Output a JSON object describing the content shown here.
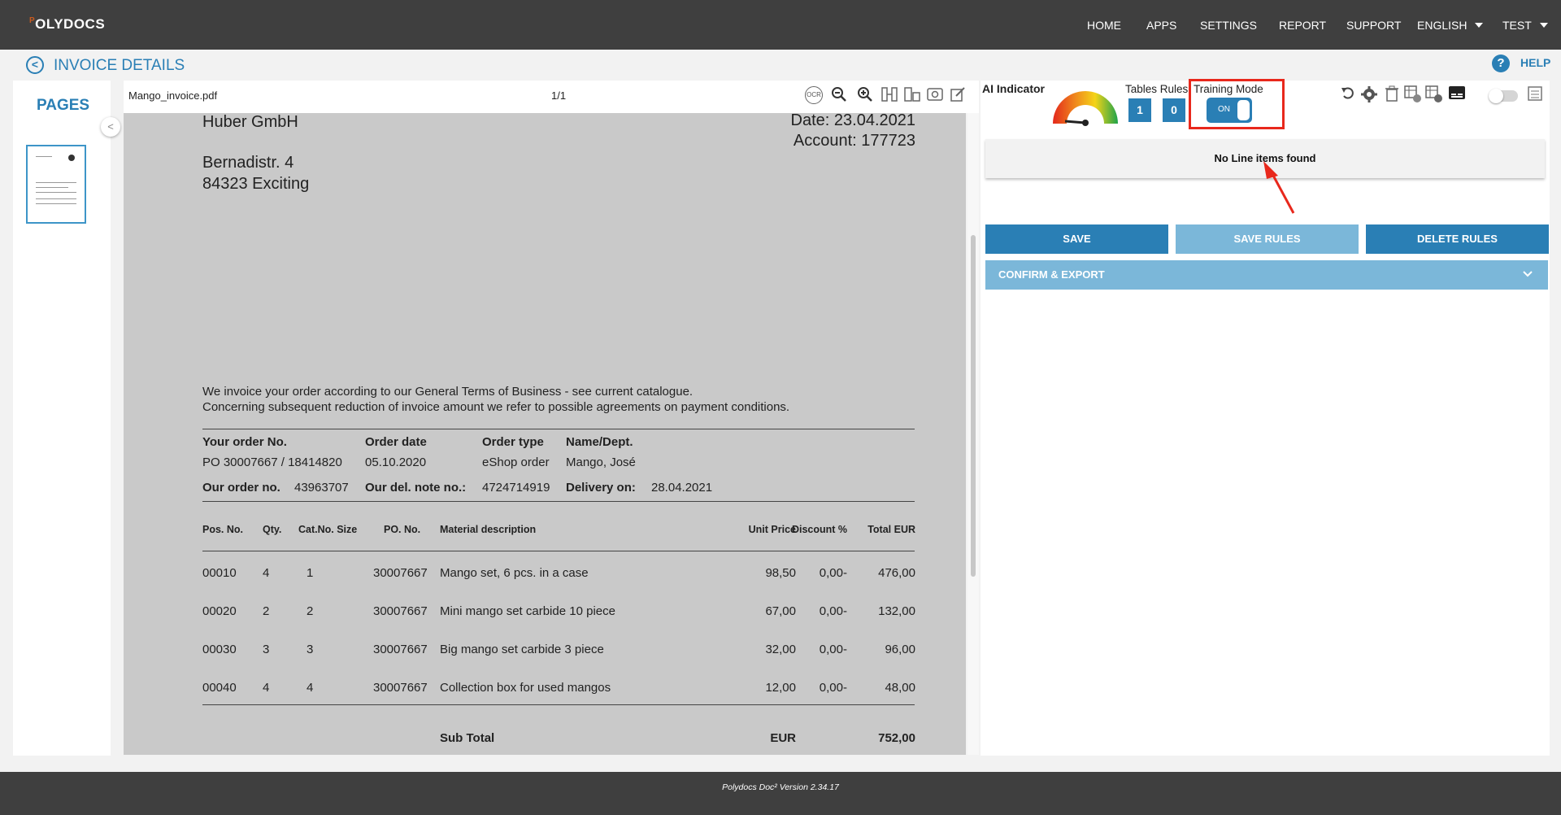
{
  "nav": {
    "logo": "OLYDOCS",
    "logo_mark": "P",
    "items": [
      "HOME",
      "APPS",
      "SETTINGS",
      "REPORT",
      "SUPPORT"
    ],
    "language": "ENGLISH",
    "user": "TEST"
  },
  "header": {
    "title": "INVOICE DETAILS",
    "help": "HELP",
    "help_icon": "?",
    "back_icon": "<"
  },
  "pages_panel": {
    "label": "PAGES",
    "collapse_icon": "<"
  },
  "viewer": {
    "filename": "Mango_invoice.pdf",
    "page_indicator": "1/1",
    "icons": [
      "ocr-icon",
      "zoom-out-icon",
      "zoom-in-icon",
      "column-icon",
      "table-icon",
      "settings-grid-icon",
      "edit-icon"
    ]
  },
  "document": {
    "company": "Huber GmbH",
    "street": "Bernadistr. 4",
    "city": "84323 Exciting",
    "date": "Date: 23.04.2021",
    "account": "Account: 177723",
    "intro1": "We invoice your order according to our General Terms of Business - see current catalogue.",
    "intro2": "Concerning subsequent reduction of invoice amount we refer to possible agreements on payment conditions.",
    "order_headers": [
      "Your order No.",
      "Order date",
      "Order type",
      "Name/Dept."
    ],
    "order_values": [
      "PO 30007667 / 18414820",
      "05.10.2020",
      "eShop order",
      "Mango, José"
    ],
    "our_order_label": "Our order no.",
    "our_order_value": "43963707",
    "del_note_label": "Our del. note no.:",
    "del_note_value": "4724714919",
    "delivery_label": "Delivery on:",
    "delivery_value": "28.04.2021",
    "table_headers": [
      "Pos. No.",
      "Qty.",
      "Cat.No. Size",
      "PO. No.",
      "Material description",
      "Unit Price",
      "Discount %",
      "Total EUR"
    ],
    "rows": [
      [
        "00010",
        "4",
        "1",
        "30007667",
        "Mango set, 6 pcs. in a case",
        "98,50",
        "0,00-",
        "476,00"
      ],
      [
        "00020",
        "2",
        "2",
        "30007667",
        "Mini mango set carbide 10 piece",
        "67,00",
        "0,00-",
        "132,00"
      ],
      [
        "00030",
        "3",
        "3",
        "30007667",
        "Big mango set carbide 3 piece",
        "32,00",
        "0,00-",
        "96,00"
      ],
      [
        "00040",
        "4",
        "4",
        "30007667",
        "Collection box for used mangos",
        "12,00",
        "0,00-",
        "48,00"
      ]
    ],
    "subtotal_label": "Sub Total",
    "subtotal_currency": "EUR",
    "subtotal_value": "752,00"
  },
  "right_panel": {
    "ai_indicator": "AI Indicator",
    "tables_rules": "Tables Rules",
    "training_mode": "Training Mode",
    "tables_count": "1",
    "rules_count": "0",
    "toggle_label": "ON",
    "toolbar_icons": [
      "undo-icon",
      "gear-icon",
      "trash-icon",
      "table-add-icon",
      "table-settings-icon",
      "subtitles-icon",
      "switch",
      "document-list-icon"
    ],
    "no_items": "No Line items found",
    "save": "SAVE",
    "save_rules": "SAVE RULES",
    "delete_rules": "DELETE RULES",
    "confirm_export": "CONFIRM & EXPORT",
    "colors": {
      "primary": "#2a7fb5",
      "disabled": "#7bb7d9",
      "highlight": "#e8281c"
    }
  },
  "footer": {
    "version": "Polydocs Doc² Version 2.34.17"
  }
}
